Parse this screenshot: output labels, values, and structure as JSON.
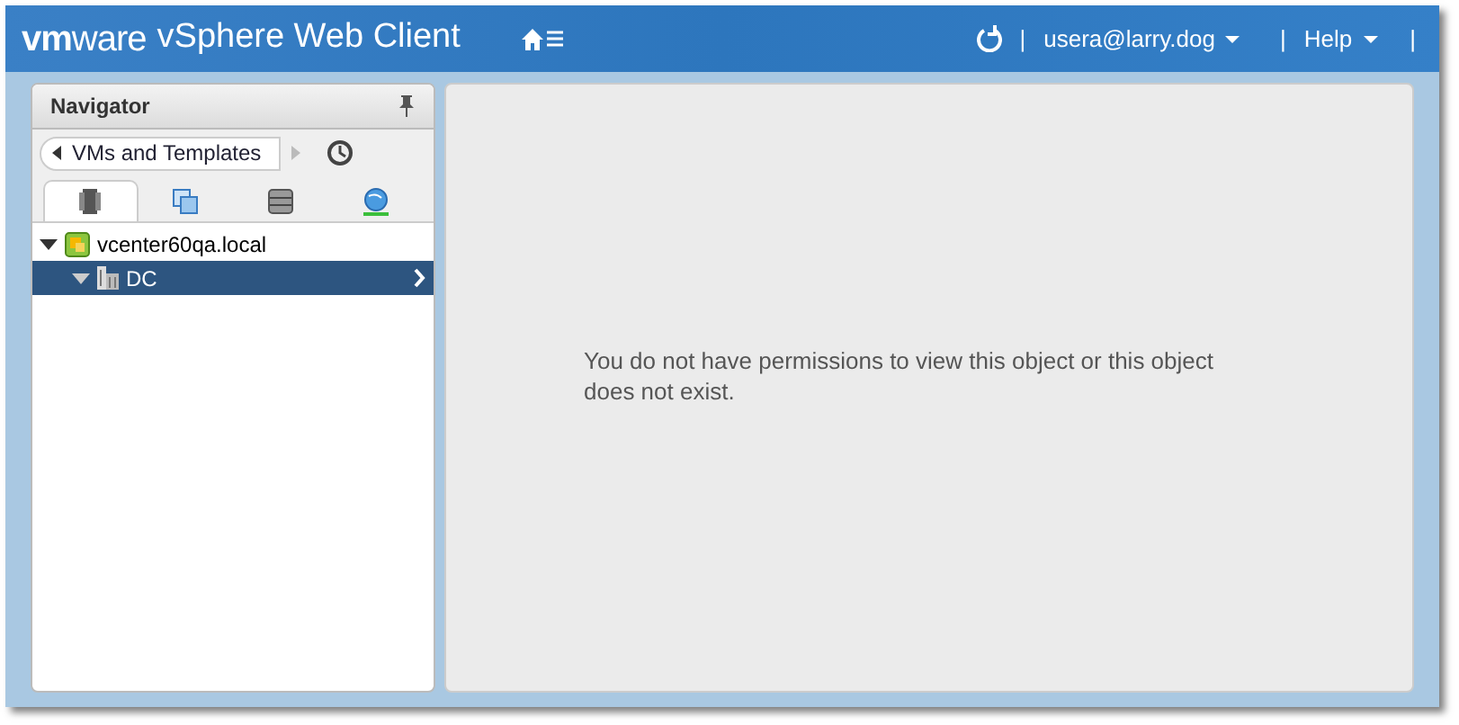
{
  "header": {
    "logo_brand": "vm",
    "logo_suffix": "ware",
    "product": "vSphere Web Client",
    "user": "usera@larry.dog",
    "help": "Help",
    "separator": "|"
  },
  "navigator": {
    "title": "Navigator",
    "breadcrumb": "VMs and Templates",
    "tabs": [
      {
        "kind": "hosts",
        "selected": true
      },
      {
        "kind": "vms",
        "selected": false
      },
      {
        "kind": "storage",
        "selected": false
      },
      {
        "kind": "network",
        "selected": false
      }
    ],
    "tree": [
      {
        "label": "vcenter60qa.local",
        "kind": "vcenter",
        "expanded": true,
        "selected": false,
        "children": [
          {
            "label": "DC",
            "kind": "datacenter",
            "expanded": true,
            "selected": true
          }
        ]
      }
    ]
  },
  "content": {
    "message": "You do not have permissions to view this object or this object does not exist."
  }
}
